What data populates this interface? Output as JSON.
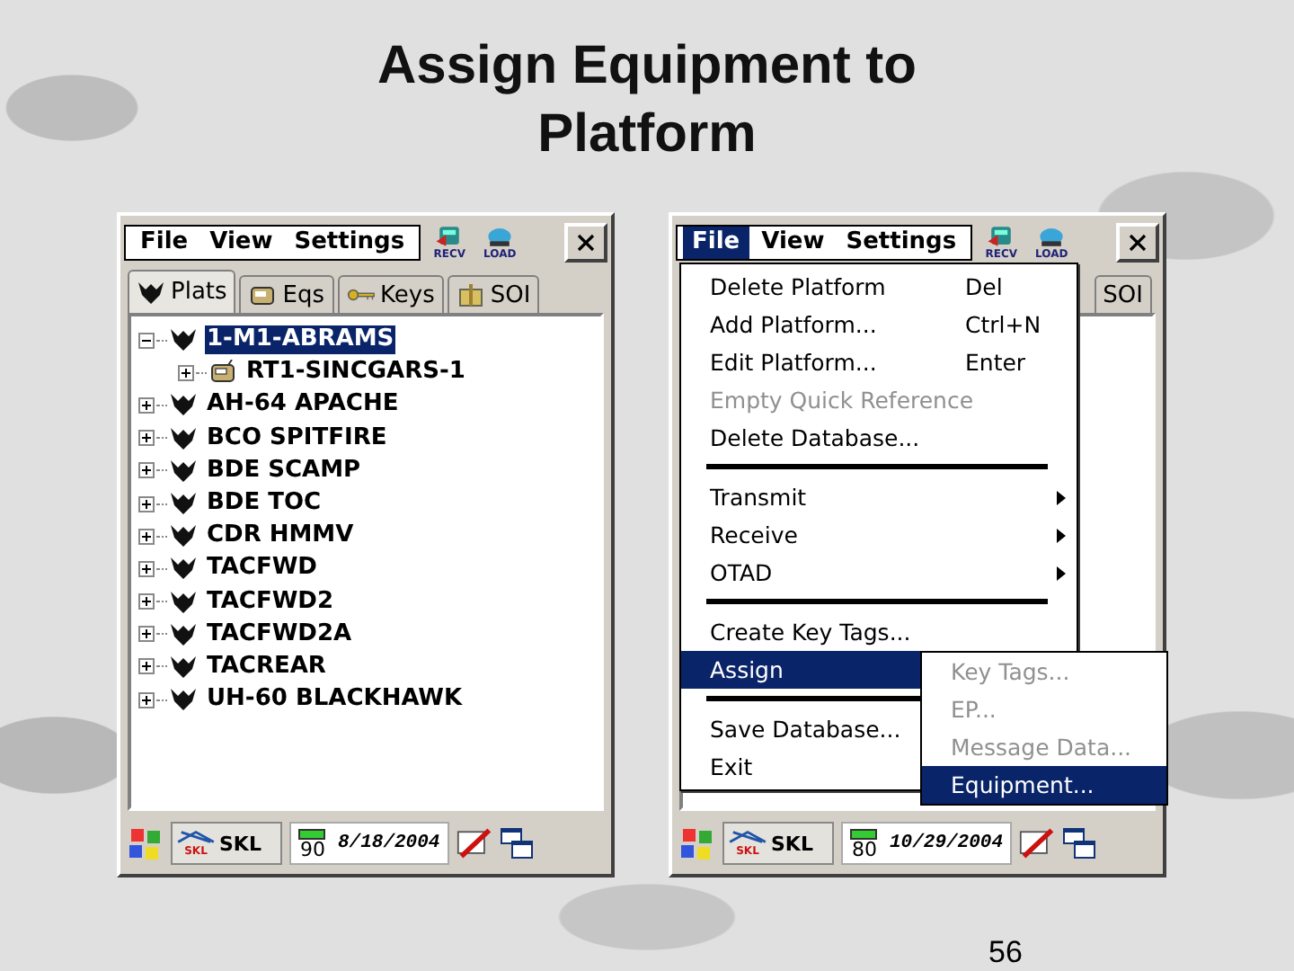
{
  "slide": {
    "title": "Assign Equipment to Platform",
    "page_number": "56"
  },
  "windows": [
    {
      "menu_bar": [
        {
          "label": "File",
          "selected": false
        },
        {
          "label": "View",
          "selected": false
        },
        {
          "label": "Settings",
          "selected": false
        }
      ],
      "toolbar_icons": [
        {
          "label": "RECV"
        },
        {
          "label": "LOAD"
        }
      ],
      "tabs": [
        {
          "label": "Plats",
          "kind": "platform",
          "selected": true
        },
        {
          "label": "Eqs",
          "kind": "equipment",
          "selected": false
        },
        {
          "label": "Keys",
          "kind": "key",
          "selected": false
        },
        {
          "label": "SOI",
          "kind": "gift",
          "selected": false
        }
      ],
      "tree": [
        {
          "label": "1-M1-ABRAMS",
          "kind": "platform",
          "selected": true,
          "expanded": true,
          "children": [
            {
              "label": "RT1-SINCGARS-1",
              "kind": "equipment",
              "selected": false,
              "expanded": false
            }
          ]
        },
        {
          "label": "AH-64 APACHE",
          "kind": "platform",
          "selected": false,
          "expanded": false
        },
        {
          "label": "BCO SPITFIRE",
          "kind": "platform",
          "selected": false,
          "expanded": false
        },
        {
          "label": "BDE SCAMP",
          "kind": "platform",
          "selected": false,
          "expanded": false
        },
        {
          "label": "BDE TOC",
          "kind": "platform",
          "selected": false,
          "expanded": false
        },
        {
          "label": "CDR HMMV",
          "kind": "platform",
          "selected": false,
          "expanded": false
        },
        {
          "label": "TACFWD",
          "kind": "platform",
          "selected": false,
          "expanded": false
        },
        {
          "label": "TACFWD2",
          "kind": "platform",
          "selected": false,
          "expanded": false
        },
        {
          "label": "TACFWD2A",
          "kind": "platform",
          "selected": false,
          "expanded": false
        },
        {
          "label": "TACREAR",
          "kind": "platform",
          "selected": false,
          "expanded": false
        },
        {
          "label": "UH-60 BLACKHAWK",
          "kind": "platform",
          "selected": false,
          "expanded": false
        }
      ],
      "taskbar": {
        "app_icon_text": "SKL",
        "app": "SKL",
        "battery": "90",
        "date": "8/18/2004"
      }
    },
    {
      "menu_bar": [
        {
          "label": "File",
          "selected": true
        },
        {
          "label": "View",
          "selected": false
        },
        {
          "label": "Settings",
          "selected": false
        }
      ],
      "toolbar_icons": [
        {
          "label": "RECV"
        },
        {
          "label": "LOAD"
        }
      ],
      "tabs": [
        {
          "label": "SOI",
          "kind": "text",
          "selected": false
        }
      ],
      "menu": [
        {
          "kind": "item",
          "label": "Delete Platform",
          "shortcut": "Del",
          "disabled": false,
          "selected": false
        },
        {
          "kind": "item",
          "label": "Add Platform...",
          "shortcut": "Ctrl+N",
          "disabled": false,
          "selected": false
        },
        {
          "kind": "item",
          "label": "Edit Platform...",
          "shortcut": "Enter",
          "disabled": false,
          "selected": false
        },
        {
          "kind": "item",
          "label": "Empty Quick Reference",
          "disabled": true,
          "selected": false
        },
        {
          "kind": "item",
          "label": "Delete Database...",
          "disabled": false,
          "selected": false
        },
        {
          "kind": "separator"
        },
        {
          "kind": "submenu",
          "label": "Transmit",
          "disabled": false,
          "selected": false
        },
        {
          "kind": "submenu",
          "label": "Receive",
          "disabled": false,
          "selected": false
        },
        {
          "kind": "submenu",
          "label": "OTAD",
          "disabled": false,
          "selected": false
        },
        {
          "kind": "separator"
        },
        {
          "kind": "item",
          "label": "Create Key Tags...",
          "disabled": false,
          "selected": false
        },
        {
          "kind": "open_submenu",
          "label": "Assign",
          "disabled": false,
          "selected": true,
          "submenu": [
            {
              "label": "Key Tags...",
              "disabled": true,
              "selected": false
            },
            {
              "label": "EP...",
              "disabled": true,
              "selected": false
            },
            {
              "label": "Message Data...",
              "disabled": true,
              "selected": false
            },
            {
              "label": "Equipment...",
              "disabled": false,
              "selected": true
            }
          ]
        },
        {
          "kind": "separator"
        },
        {
          "kind": "item",
          "label": "Save Database...",
          "disabled": false,
          "selected": false
        },
        {
          "kind": "item",
          "label": "Exit",
          "disabled": false,
          "selected": false
        }
      ],
      "taskbar": {
        "app_icon_text": "SKL",
        "app": "SKL",
        "battery": "80",
        "date": "10/29/2004"
      }
    }
  ]
}
